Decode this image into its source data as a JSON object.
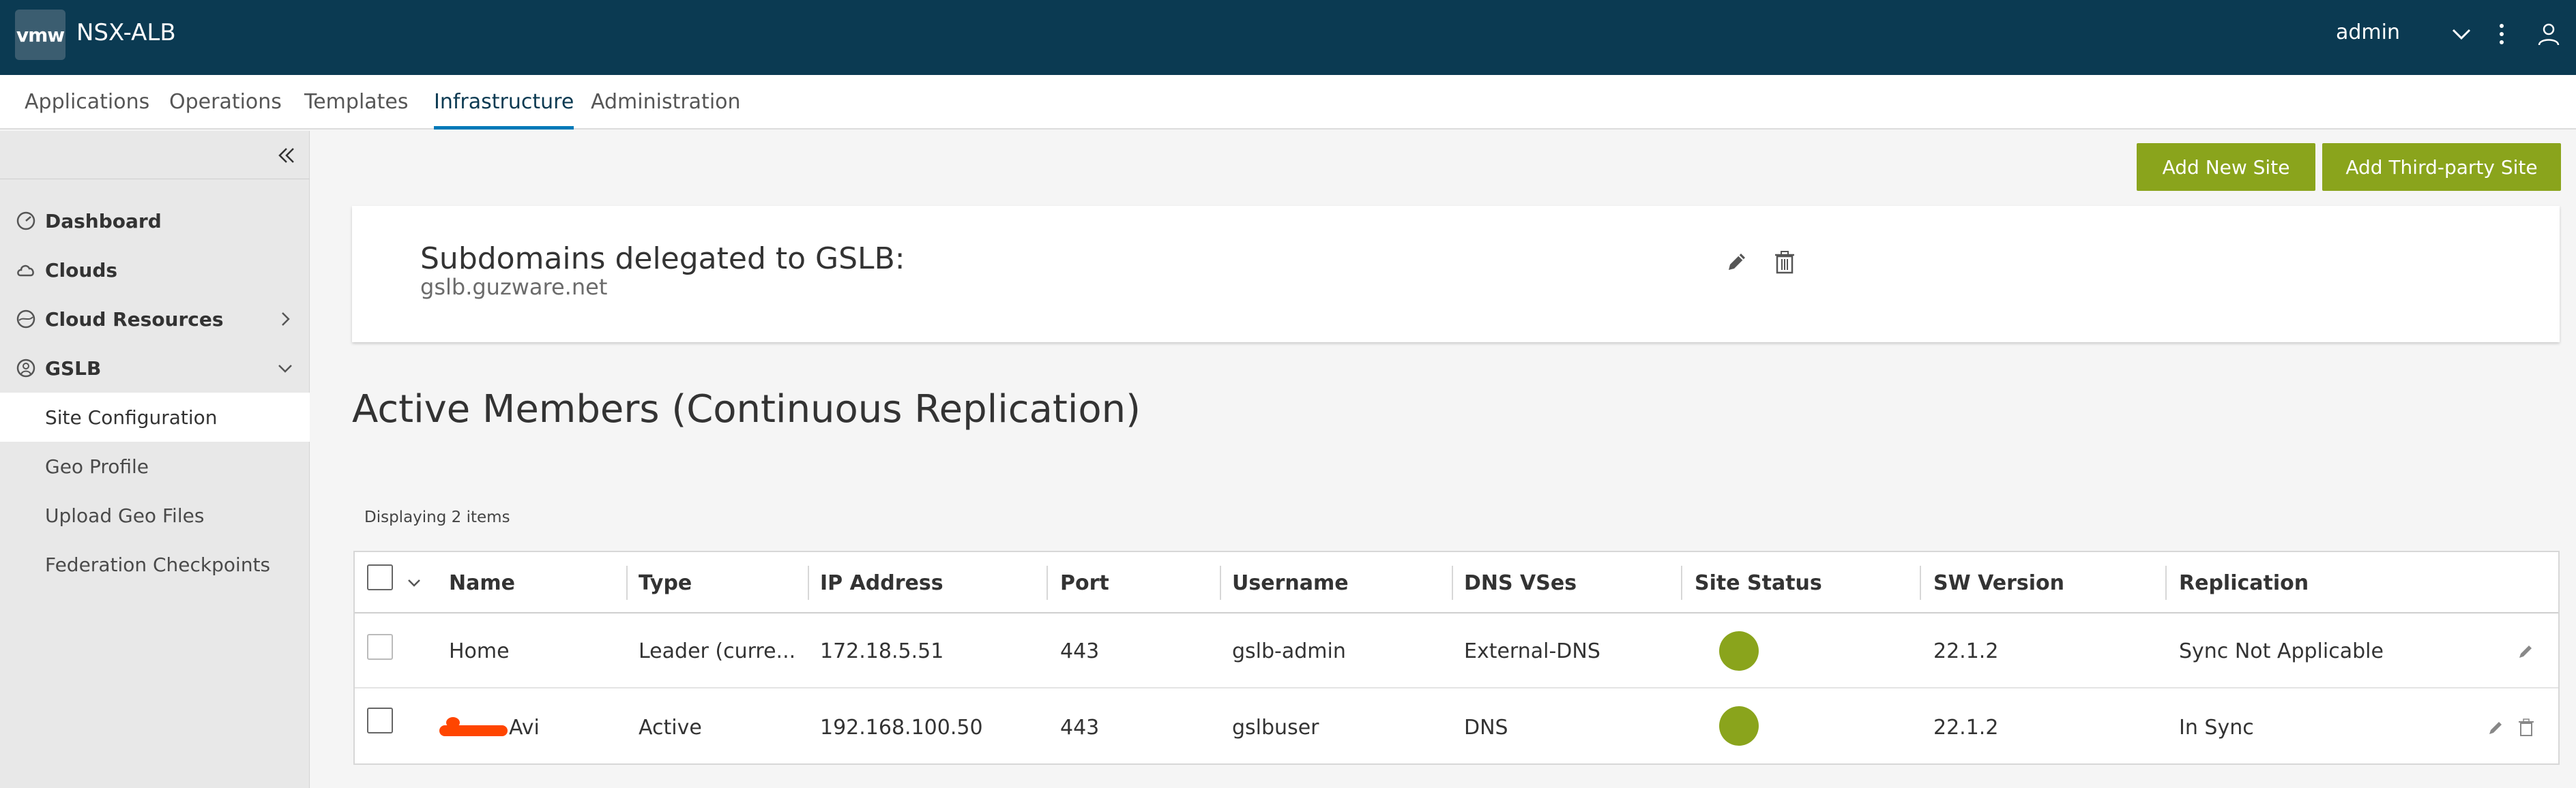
{
  "header": {
    "logo_text": "vmw",
    "app_title": "NSX-ALB",
    "user": "admin"
  },
  "nav": {
    "tabs": [
      "Applications",
      "Operations",
      "Templates",
      "Infrastructure",
      "Administration"
    ],
    "active": "Infrastructure"
  },
  "sidebar": {
    "items": [
      {
        "label": "Dashboard",
        "icon": "dashboard-icon"
      },
      {
        "label": "Clouds",
        "icon": "cloud-icon"
      },
      {
        "label": "Cloud Resources",
        "icon": "cloud-resources-icon",
        "chevron": "right"
      },
      {
        "label": "GSLB",
        "icon": "gslb-icon",
        "chevron": "down"
      }
    ],
    "subitems": [
      "Site Configuration",
      "Geo Profile",
      "Upload Geo Files",
      "Federation Checkpoints"
    ],
    "active_subitem": "Site Configuration"
  },
  "actions": {
    "add_new_site": "Add New Site",
    "add_third_party_site": "Add Third-party Site"
  },
  "subdomains": {
    "title": "Subdomains delegated to GSLB:",
    "value": "gslb.guzware.net"
  },
  "section_title": "Active Members (Continuous Replication)",
  "table": {
    "display_count": "Displaying 2 items",
    "columns": [
      "Name",
      "Type",
      "IP Address",
      "Port",
      "Username",
      "DNS VSes",
      "Site Status",
      "SW Version",
      "Replication"
    ],
    "rows": [
      {
        "name": "Home",
        "type": "Leader (curre...",
        "ip": "172.18.5.51",
        "port": "443",
        "username": "gslb-admin",
        "dns_vses": "External-DNS",
        "site_status": "up",
        "sw_version": "22.1.2",
        "replication": "Sync Not Applicable"
      },
      {
        "name": "Avi",
        "type": "Active",
        "ip": "192.168.100.50",
        "port": "443",
        "username": "gslbuser",
        "dns_vses": "DNS",
        "site_status": "up",
        "sw_version": "22.1.2",
        "replication": "In Sync"
      }
    ]
  },
  "colors": {
    "header_bg": "#0b3a52",
    "accent_green": "#8aa41c",
    "status_up": "#8aa41c",
    "tab_underline": "#0079b8",
    "redaction": "#ff4500"
  }
}
